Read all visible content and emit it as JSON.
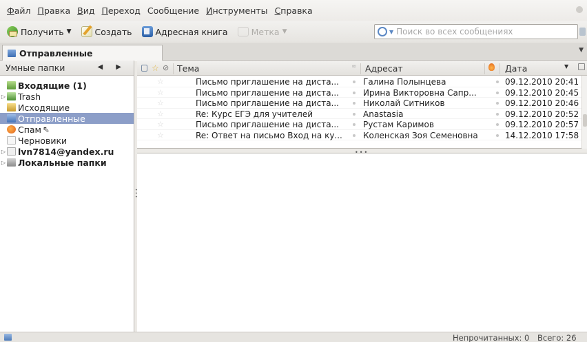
{
  "menubar": {
    "items": [
      {
        "underlined": "Ф",
        "rest": "айл"
      },
      {
        "underlined": "П",
        "rest": "равка"
      },
      {
        "underlined": "В",
        "rest": "ид"
      },
      {
        "underlined": "П",
        "rest": "ереход"
      },
      {
        "underlined": "",
        "rest": "Сообщение"
      },
      {
        "underlined": "И",
        "rest": "нструменты"
      },
      {
        "underlined": "С",
        "rest": "правка"
      }
    ]
  },
  "toolbar": {
    "get_label": "Получить",
    "write_label": "Создать",
    "addressbook_label": "Адресная книга",
    "tag_label": "Метка",
    "search_placeholder": "Поиск во всех сообщениях"
  },
  "tab": {
    "title": "Отправленные"
  },
  "sidebar": {
    "header": "Умные папки",
    "folders": [
      {
        "label": "Входящие (1)",
        "icon": "inbox-icon"
      },
      {
        "label": "Trash",
        "icon": "trash-icon"
      },
      {
        "label": "Исходящие",
        "icon": "outbox-icon"
      },
      {
        "label": "Отправленные",
        "icon": "sent-icon"
      },
      {
        "label": "Спам",
        "icon": "spam-icon"
      },
      {
        "label": "Черновики",
        "icon": "drafts-icon"
      },
      {
        "label": "lvn7814@yandex.ru",
        "icon": "account-icon"
      },
      {
        "label": "Локальные папки",
        "icon": "local-folders-icon"
      }
    ]
  },
  "columns": {
    "subject": "Тема",
    "recipient": "Адресат",
    "date": "Дата"
  },
  "messages": [
    {
      "subject": "Письмо приглашение на диста...",
      "recipient": "Галина Полынцева",
      "date": "09.12.2010 20:41"
    },
    {
      "subject": "Письмо приглашение на диста...",
      "recipient": "Ирина Викторовна Сапр...",
      "date": "09.12.2010 20:45"
    },
    {
      "subject": "Письмо приглашение на диста...",
      "recipient": "Николай Ситников",
      "date": "09.12.2010 20:46"
    },
    {
      "subject": "Re: Курс ЕГЭ для учителей",
      "recipient": "Anastasia",
      "date": "09.12.2010 20:52"
    },
    {
      "subject": "Письмо приглашение на диста...",
      "recipient": "Рустам Каримов",
      "date": "09.12.2010 20:57"
    },
    {
      "subject": "Re: Ответ на письмо Вход на ку...",
      "recipient": "Коленская Зоя Семеновна",
      "date": "14.12.2010 17:58"
    }
  ],
  "status": {
    "unread": "Непрочитанных: 0",
    "total": "Всего: 26"
  }
}
